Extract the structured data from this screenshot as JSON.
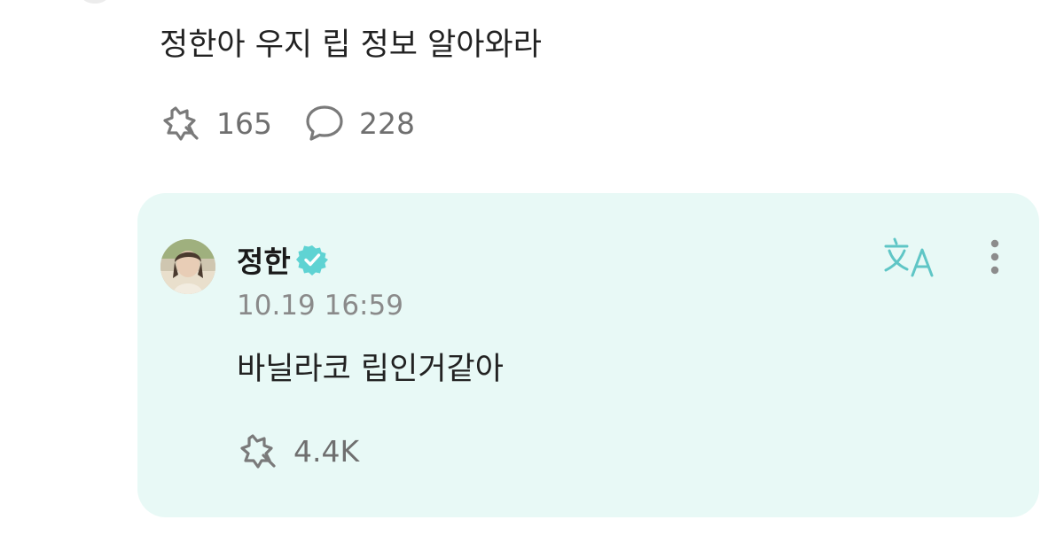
{
  "post": {
    "text": "정한아 우지 립 정보 알아와라",
    "likes": "165",
    "comments": "228"
  },
  "reply": {
    "author": "정한",
    "verified": true,
    "timestamp": "10.19 16:59",
    "text": "바닐라코 립인거같아",
    "likes": "4.4K"
  },
  "icons": {
    "like": "starburst-heart-icon",
    "comment": "speech-bubble-icon",
    "verified": "verified-badge-icon",
    "translate": "translate-icon",
    "more": "more-vertical-icon"
  },
  "colors": {
    "card_background": "#e8f9f6",
    "verified_badge": "#5fd3d3",
    "translate_icon": "#5fc6c6",
    "icon_gray": "#7a7a7a",
    "text_dark": "#222222",
    "text_muted": "#8a8a8a"
  }
}
